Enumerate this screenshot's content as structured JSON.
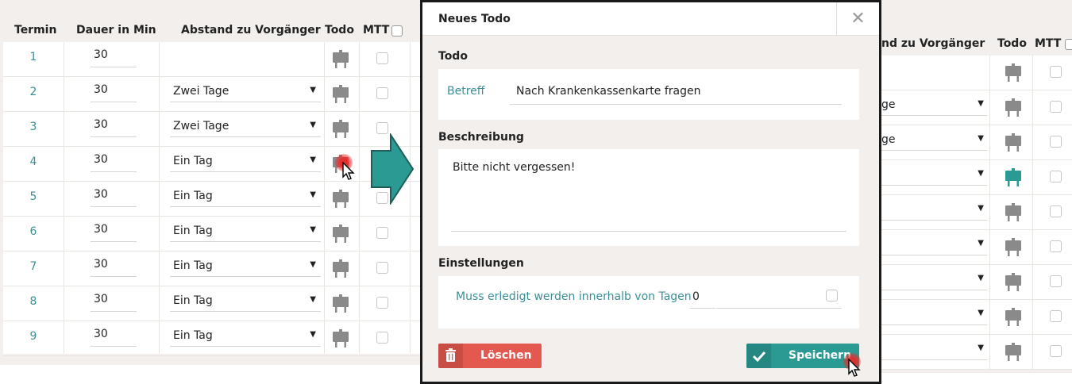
{
  "left_table": {
    "headers": [
      "Termin",
      "Dauer in Min",
      "Abstand zu Vorgänger",
      "Todo",
      "MTT"
    ],
    "rows": [
      {
        "termin": "1",
        "dauer": "30",
        "abstand": ""
      },
      {
        "termin": "2",
        "dauer": "30",
        "abstand": "Zwei Tage"
      },
      {
        "termin": "3",
        "dauer": "30",
        "abstand": "Zwei Tage"
      },
      {
        "termin": "4",
        "dauer": "30",
        "abstand": "Ein Tag"
      },
      {
        "termin": "5",
        "dauer": "30",
        "abstand": "Ein Tag"
      },
      {
        "termin": "6",
        "dauer": "30",
        "abstand": "Ein Tag"
      },
      {
        "termin": "7",
        "dauer": "30",
        "abstand": "Ein Tag"
      },
      {
        "termin": "8",
        "dauer": "30",
        "abstand": "Ein Tag"
      },
      {
        "termin": "9",
        "dauer": "30",
        "abstand": "Ein Tag"
      }
    ]
  },
  "modal": {
    "title": "Neues Todo",
    "close_glyph": "✕",
    "section_todo": "Todo",
    "betreff_label": "Betreff",
    "betreff_value": "Nach Krankenkassenkarte fragen",
    "section_beschreibung": "Beschreibung",
    "beschreibung_value": "Bitte nicht vergessen!",
    "section_einstellungen": "Einstellungen",
    "einstellungen_label": "Muss erledigt werden innerhalb von Tagen",
    "einstellungen_value": "0",
    "delete_label": "Löschen",
    "save_label": "Speichern"
  },
  "right_table": {
    "headers": [
      "nd zu Vorgänger",
      "Todo",
      "MTT"
    ],
    "rows": [
      {
        "abstand": ""
      },
      {
        "abstand": "ge"
      },
      {
        "abstand": "ge"
      },
      {
        "abstand": ""
      },
      {
        "abstand": ""
      },
      {
        "abstand": ""
      },
      {
        "abstand": ""
      },
      {
        "abstand": ""
      },
      {
        "abstand": ""
      }
    ],
    "active_todo_row": 3
  },
  "colors": {
    "accent": "#3a8f96",
    "icon_gray": "#8a8a8a",
    "icon_active": "#2a9a93",
    "delete": "#e3584f",
    "save": "#2a9a93",
    "panel_bg": "#f2efec"
  },
  "icons": {
    "todo": "easel-icon",
    "delete": "trash-icon",
    "save": "check-icon",
    "arrow": "arrow-right-icon"
  }
}
